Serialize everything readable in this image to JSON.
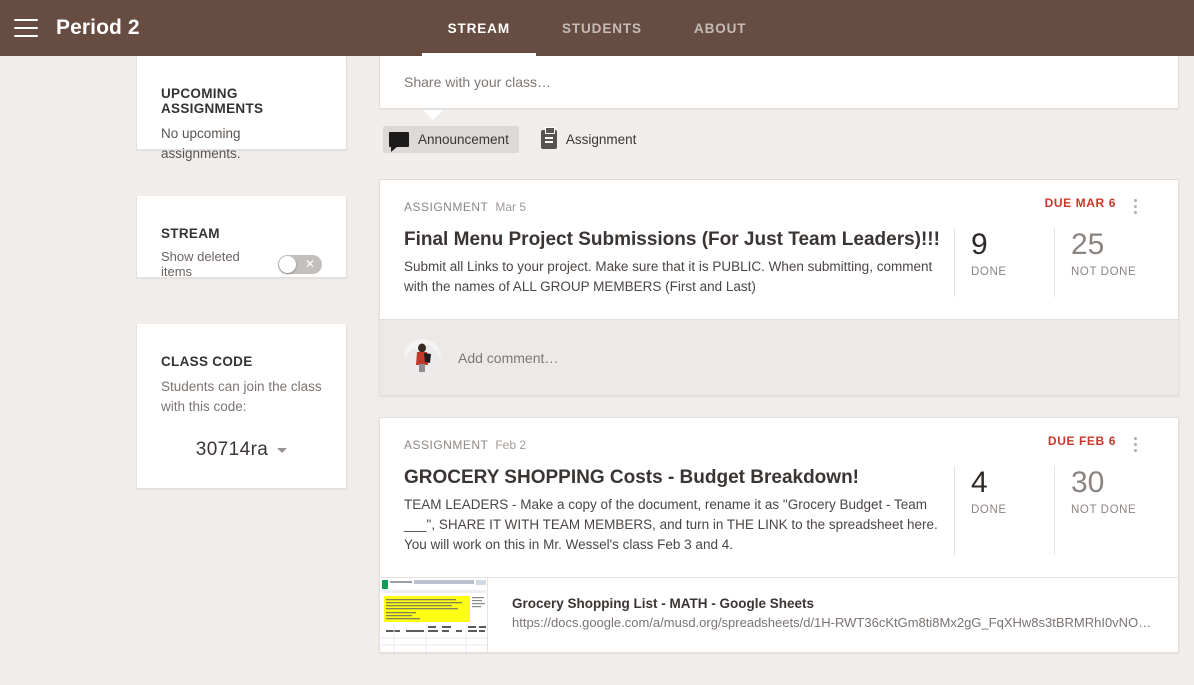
{
  "appbar": {
    "menu_icon": "hamburger-menu-icon",
    "title": "Period 2",
    "tabs": [
      {
        "label": "STREAM",
        "active": true
      },
      {
        "label": "STUDENTS",
        "active": false
      },
      {
        "label": "ABOUT",
        "active": false
      }
    ]
  },
  "sidebar": {
    "upcoming": {
      "heading": "UPCOMING ASSIGNMENTS",
      "body": "No upcoming assignments."
    },
    "stream": {
      "heading": "STREAM",
      "toggle_label": "Show deleted items",
      "toggle_state": "off",
      "toggle_glyph": "✕"
    },
    "class_code": {
      "heading": "CLASS CODE",
      "body": "Students can join the class with this code:",
      "code": "30714ra"
    }
  },
  "composer": {
    "placeholder": "Share with your class…",
    "chips": [
      {
        "label": "Announcement",
        "icon": "announcement-icon",
        "selected": true
      },
      {
        "label": "Assignment",
        "icon": "clipboard-icon",
        "selected": false
      }
    ]
  },
  "posts": [
    {
      "kind": "ASSIGNMENT",
      "date": "Mar 5",
      "title": "Final Menu Project Submissions (For Just Team Leaders)!!!",
      "description": "Submit all Links to your project. Make sure that it is PUBLIC. When submitting, comment with the names of ALL GROUP MEMBERS (First and Last)",
      "due": "DUE MAR 6",
      "done_count": "9",
      "done_label": "DONE",
      "notdone_count": "25",
      "notdone_label": "NOT DONE",
      "comment_placeholder": "Add comment…"
    },
    {
      "kind": "ASSIGNMENT",
      "date": "Feb 2",
      "title": "GROCERY SHOPPING Costs - Budget Breakdown!",
      "description": "TEAM LEADERS - Make a copy of the document, rename it as \"Grocery Budget - Team ___\", SHARE IT WITH TEAM MEMBERS, and turn in THE LINK to the spreadsheet here. You will work on this in Mr. Wessel's class Feb 3 and 4.",
      "due": "DUE FEB 6",
      "done_count": "4",
      "done_label": "DONE",
      "notdone_count": "30",
      "notdone_label": "NOT DONE",
      "attachment": {
        "title": "Grocery Shopping List - MATH - Google Sheets",
        "url": "https://docs.google.com/a/musd.org/spreadsheets/d/1H-RWT36cKtGm8ti8Mx2gG_FqXHw8s3tBRMRhI0vNOQk/edit?…"
      }
    }
  ],
  "colors": {
    "appbar": "#664C41",
    "page_bg": "#F1EDEB",
    "due_red": "#C9392B",
    "card_bg": "#FFFFFF"
  }
}
